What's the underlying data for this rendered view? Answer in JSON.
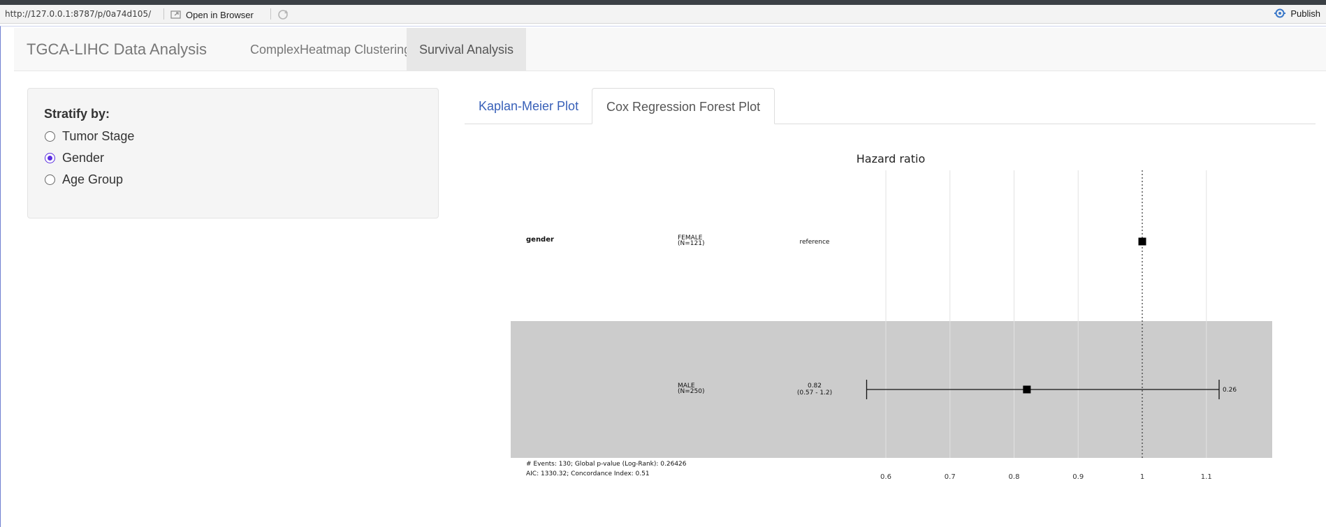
{
  "browser": {
    "url": "http://127.0.0.1:8787/p/0a74d105/",
    "open_in_browser": "Open in Browser",
    "publish": "Publish"
  },
  "navbar": {
    "brand": "TGCA-LIHC Data Analysis",
    "items": [
      {
        "label": "ComplexHeatmap Clustering",
        "active": false
      },
      {
        "label": "Survival Analysis",
        "active": true
      }
    ]
  },
  "sidebar": {
    "label": "Stratify by:",
    "options": [
      {
        "label": "Tumor Stage",
        "checked": false
      },
      {
        "label": "Gender",
        "checked": true
      },
      {
        "label": "Age Group",
        "checked": false
      }
    ]
  },
  "tabs": [
    {
      "label": "Kaplan-Meier Plot",
      "active": false
    },
    {
      "label": "Cox Regression Forest Plot",
      "active": true
    }
  ],
  "chart_data": {
    "type": "forest",
    "title": "Hazard ratio",
    "x_ticks": [
      0.6,
      0.7,
      0.8,
      0.9,
      1,
      1.1
    ],
    "x_tick_labels": [
      "0.6",
      "0.7",
      "0.8",
      "0.9",
      "1",
      "1.1"
    ],
    "reference_line": 1,
    "xlim": [
      0.555,
      1.2
    ],
    "variable": "gender",
    "rows": [
      {
        "level": "FEMALE",
        "n": "(N=121)",
        "estimate_text": "reference",
        "ci_text": "",
        "hr": 1,
        "lower": null,
        "upper": null,
        "p_text": "",
        "shaded": false
      },
      {
        "level": "MALE",
        "n": "(N=250)",
        "estimate_text": "0.82",
        "ci_text": "(0.57 - 1.2)",
        "hr": 0.82,
        "lower": 0.57,
        "upper": 1.2,
        "p_text": "0.26",
        "shaded": true
      }
    ],
    "footer": [
      "# Events: 130; Global p-value (Log-Rank): 0.26426",
      "AIC: 1330.32; Concordance Index: 0.51"
    ]
  }
}
